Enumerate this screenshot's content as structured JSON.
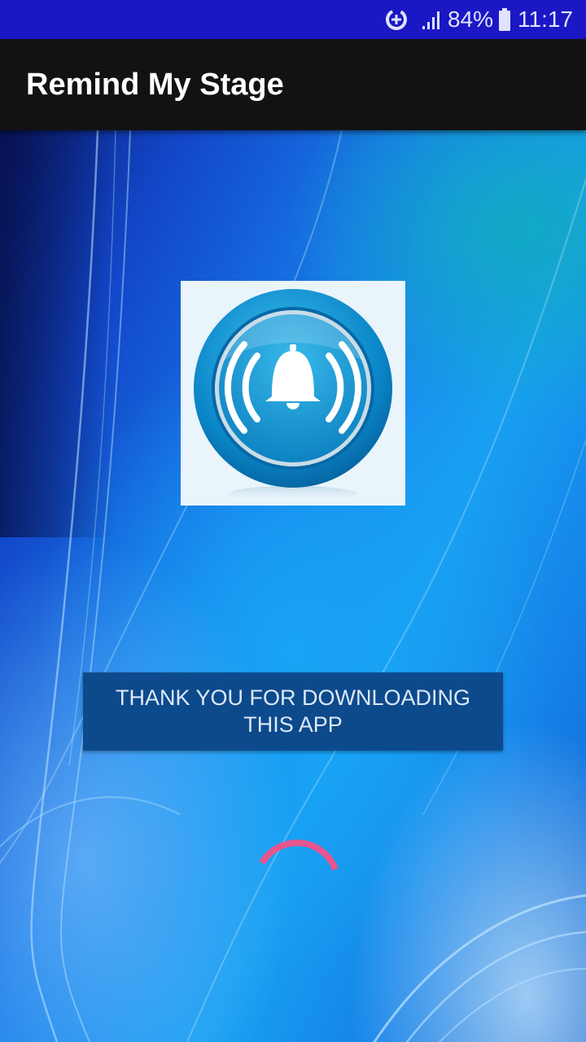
{
  "status_bar": {
    "battery_percent": "84%",
    "time": "11:17",
    "icons": [
      "data-saver-icon",
      "signal-icon",
      "battery-icon"
    ]
  },
  "app_bar": {
    "title": "Remind My Stage"
  },
  "splash": {
    "logo_icon": "bell-alarm-icon",
    "message": "THANK YOU FOR DOWNLOADING THIS APP",
    "loading": true
  },
  "colors": {
    "status_bar": "#1a17c4",
    "app_bar": "#121212",
    "banner": "#0d4a8c",
    "spinner": "#e8558e"
  }
}
